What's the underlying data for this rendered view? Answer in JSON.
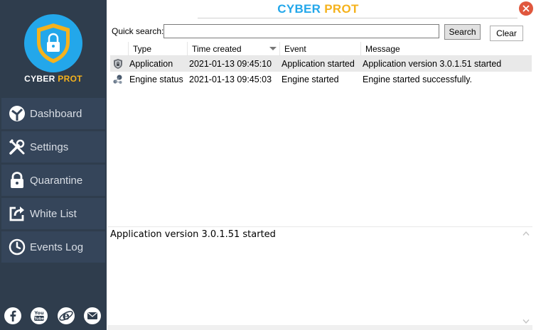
{
  "brand": {
    "logo_word1": "CYBER",
    "logo_word2": "PROT",
    "title_word1": "CYBER",
    "title_word2": "PROT",
    "primary_color": "#23a7ea",
    "accent_color": "#f5b21c",
    "sidebar_color": "#2f3d4d"
  },
  "sidebar": {
    "items": [
      {
        "label": "Dashboard",
        "icon": "dashboard-icon"
      },
      {
        "label": "Settings",
        "icon": "settings-icon"
      },
      {
        "label": "Quarantine",
        "icon": "lock-icon"
      },
      {
        "label": "White List",
        "icon": "share-icon"
      },
      {
        "label": "Events Log",
        "icon": "clock-icon"
      }
    ],
    "social": [
      "facebook-icon",
      "youtube-icon",
      "internet-explorer-icon",
      "email-icon"
    ]
  },
  "search": {
    "label": "Quick search:",
    "value": "",
    "search_button": "Search",
    "clear_button": "Clear"
  },
  "table": {
    "columns": [
      "Type",
      "Time created",
      "Event",
      "Message"
    ],
    "rows": [
      {
        "icon": "shield-icon",
        "type": "Application",
        "time": "2021-01-13 09:45:10",
        "event": "Application started",
        "message": "Application version 3.0.1.51 started"
      },
      {
        "icon": "engine-icon",
        "type": "Engine status",
        "time": "2021-01-13 09:45:03",
        "event": "Engine started",
        "message": "Engine started successfully."
      }
    ]
  },
  "detail": {
    "text": "Application version 3.0.1.51 started"
  }
}
